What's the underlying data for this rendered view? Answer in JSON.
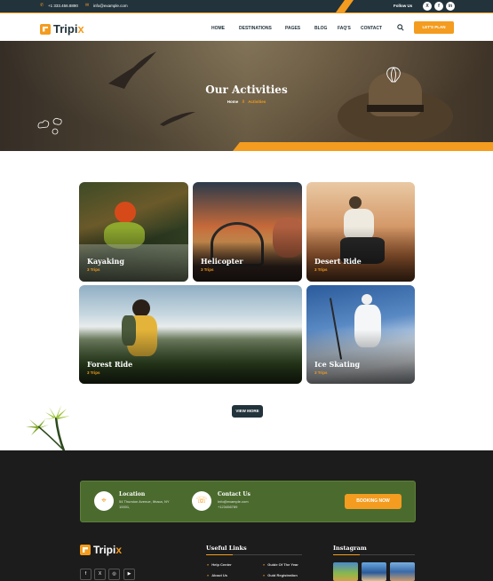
{
  "topbar": {
    "phone": "+1 333.456.8890",
    "email": "info@example.com",
    "follow_label": "Follow Us",
    "social": [
      "X",
      "f",
      "in"
    ]
  },
  "header": {
    "brand": "Tripi",
    "brand_accent": "x",
    "nav": [
      "HOME",
      "DESTINATIONS",
      "PAGES",
      "BLOG",
      "FAQ'S",
      "CONTACT"
    ],
    "cta": "LET'S PLAN"
  },
  "hero": {
    "title": "Our Activities",
    "breadcrumb_home": "Home",
    "breadcrumb_sep": "//",
    "breadcrumb_current": "Activities"
  },
  "activities": [
    {
      "title": "Kayaking",
      "trips": "3 Trips"
    },
    {
      "title": "Helicopter",
      "trips": "3 Trips"
    },
    {
      "title": "Desert Ride",
      "trips": "3 Trips"
    },
    {
      "title": "Forest Ride",
      "trips": "3 Trips"
    },
    {
      "title": "Ice Skating",
      "trips": "3 Trips"
    }
  ],
  "view_more": "VIEW MORE",
  "footer": {
    "location_title": "Location",
    "location_line1": "54 Thurston Avenue, Ithaca, NY",
    "location_line2": "10001,",
    "contact_title": "Contact Us",
    "contact_email": "Info@example.com",
    "contact_phone": "+123456789",
    "booking_button": "BOOKING NOW",
    "brand": "Tripi",
    "brand_accent": "x",
    "social": [
      "f",
      "X",
      "◎",
      "▶"
    ],
    "useful_links_title": "Useful Links",
    "links_col1": [
      "Help Center",
      "About Us"
    ],
    "links_col2": [
      "Guide Of The Year",
      "Guid Registration"
    ],
    "instagram_title": "Instagram"
  },
  "colors": {
    "accent": "#f39c1f",
    "dark": "#22333b",
    "footer_bg": "#1c1c1c",
    "info_green": "#4b6b2e"
  }
}
